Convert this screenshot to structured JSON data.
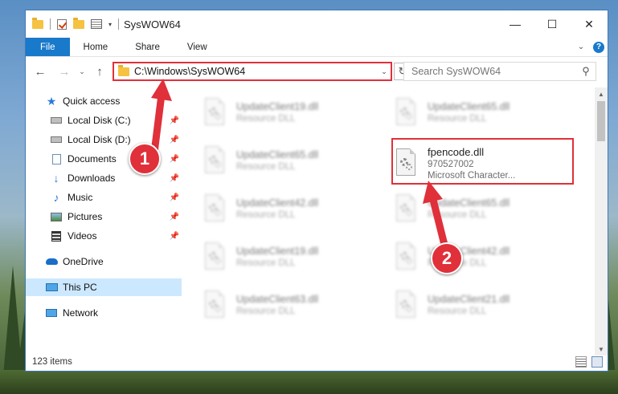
{
  "window": {
    "title": "SysWOW64",
    "controls": {
      "minimize": "—",
      "maximize": "☐",
      "close": "✕"
    }
  },
  "ribbon": {
    "tabs": [
      "File",
      "Home",
      "Share",
      "View"
    ],
    "help": "?"
  },
  "nav": {
    "back": "←",
    "forward": "→",
    "up": "↑",
    "address": "C:\\Windows\\SysWOW64",
    "search_placeholder": "Search SysWOW64"
  },
  "sidebar": {
    "items": [
      {
        "label": "Quick access",
        "icon": "star-icon"
      },
      {
        "label": "Local Disk (C:)",
        "icon": "drive-icon",
        "pinned": true
      },
      {
        "label": "Local Disk (D:)",
        "icon": "drive-icon",
        "pinned": true
      },
      {
        "label": "Documents",
        "icon": "documents-icon",
        "pinned": true
      },
      {
        "label": "Downloads",
        "icon": "downloads-icon",
        "pinned": true
      },
      {
        "label": "Music",
        "icon": "music-icon",
        "pinned": true
      },
      {
        "label": "Pictures",
        "icon": "pictures-icon",
        "pinned": true
      },
      {
        "label": "Videos",
        "icon": "videos-icon",
        "pinned": true
      },
      {
        "label": "OneDrive",
        "icon": "cloud-icon"
      },
      {
        "label": "This PC",
        "icon": "computer-icon",
        "selected": true
      },
      {
        "label": "Network",
        "icon": "network-icon"
      }
    ]
  },
  "files": [
    {
      "name": "UpdateClient19.dll",
      "sub": "Resource DLL"
    },
    {
      "name": "UpdateClient65.dll",
      "sub": "Resource DLL"
    },
    {
      "name": "UpdateClient65.dll",
      "sub": "Resource DLL"
    },
    {
      "name": "fpencode.dll",
      "sub": "970527002",
      "sub2": "Microsoft Character...",
      "highlighted": true
    },
    {
      "name": "UpdateClient42.dll",
      "sub": "Resource DLL"
    },
    {
      "name": "UpdateClient65.dll",
      "sub": "Resource DLL"
    },
    {
      "name": "UpdateClient19.dll",
      "sub": "Resource DLL"
    },
    {
      "name": "UpdateClient42.dll",
      "sub": "Resource DLL"
    },
    {
      "name": "UpdateClient63.dll",
      "sub": "Resource DLL"
    },
    {
      "name": "UpdateClient21.dll",
      "sub": "Resource DLL"
    }
  ],
  "status": {
    "count": "123 items"
  },
  "callouts": [
    "1",
    "2"
  ],
  "colors": {
    "accent": "#1979ca",
    "highlight": "#e0303a",
    "selection": "#cce8ff"
  }
}
